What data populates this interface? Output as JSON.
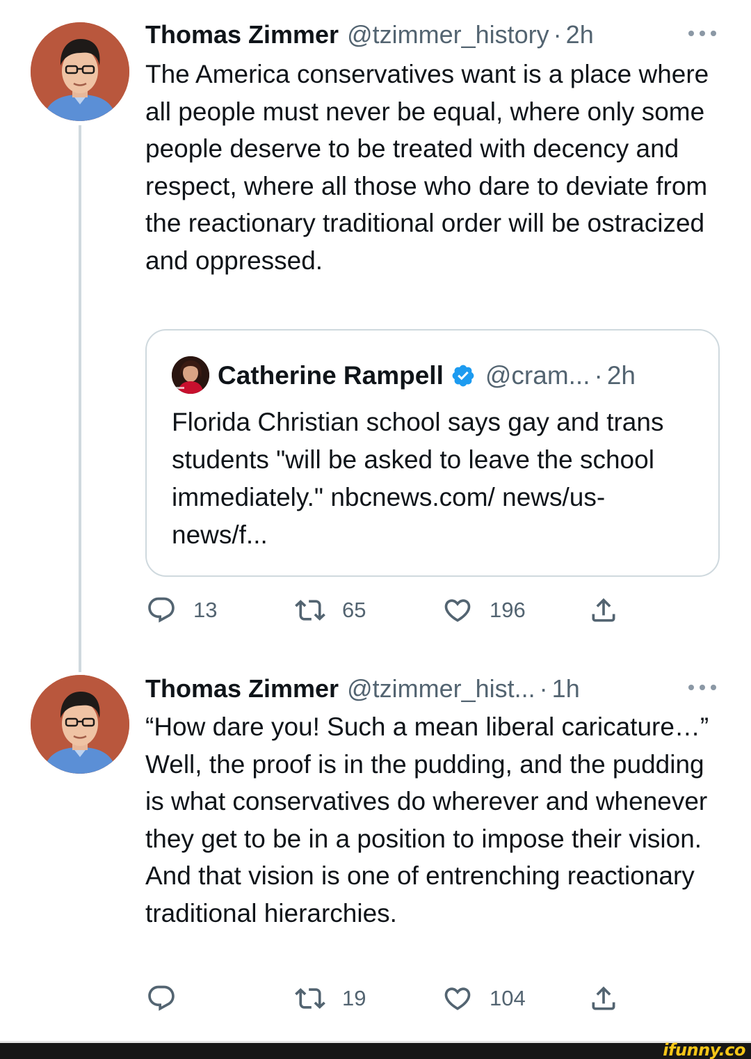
{
  "tweets": [
    {
      "author_name": "Thomas Zimmer",
      "handle": "@tzimmer_history",
      "time": "2h",
      "text": "The America conservatives want is a place where all people must never be equal, where only some people deserve to be treated with decency and respect, where all those who dare to deviate from the reactionary traditional order will be ostracized and oppressed.",
      "quote": {
        "author_name": "Catherine Rampell",
        "handle": "@cram...",
        "time": "2h",
        "verified": true,
        "text": "Florida Christian school says gay and trans students \"will be asked to leave the school immediately.\" nbcnews.com/ news/us-news/f..."
      },
      "actions": {
        "replies": "13",
        "retweets": "65",
        "likes": "196"
      }
    },
    {
      "author_name": "Thomas Zimmer",
      "handle": "@tzimmer_hist...",
      "time": "1h",
      "text": "“How dare you! Such a mean liberal caricature…” Well, the proof is in the pudding, and the pudding is what conservatives do wherever and whenever they get to be in a position to impose their vision. And that vision is one of entrenching reactionary traditional hierarchies.",
      "actions": {
        "replies": "",
        "retweets": "19",
        "likes": "104"
      }
    }
  ],
  "separator": "·",
  "watermark": "ifunny.co",
  "colors": {
    "text": "#0f1419",
    "secondary": "#536471",
    "border": "#cfd9de",
    "verified": "#1d9bf0"
  },
  "icons": [
    "more-icon",
    "reply-icon",
    "retweet-icon",
    "like-icon",
    "share-icon",
    "verified-badge-icon"
  ]
}
